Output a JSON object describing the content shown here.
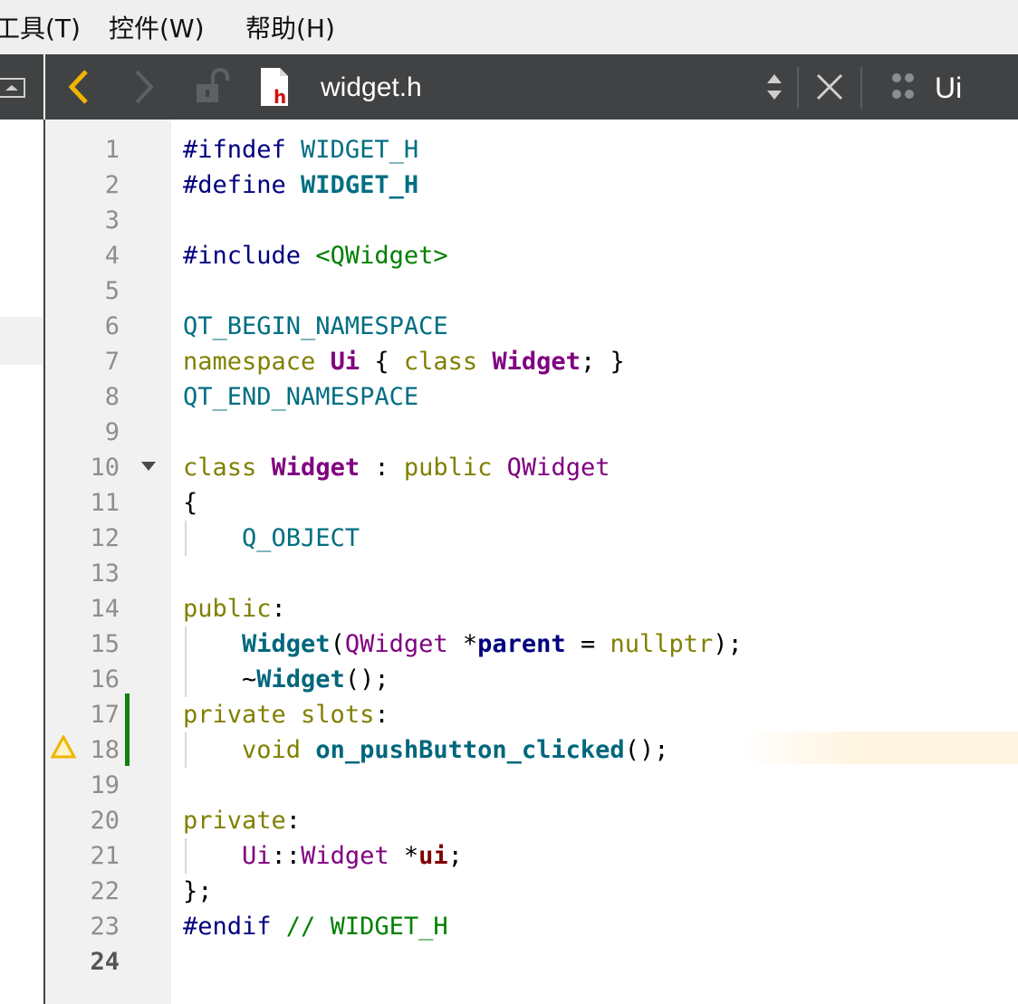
{
  "menubar": {
    "items": [
      {
        "label": "工具(T)"
      },
      {
        "label": "控件(W)"
      },
      {
        "label": "帮助(H)"
      }
    ]
  },
  "toolbar": {
    "file_name": "widget.h",
    "file_type_badge": "h",
    "symbol_label": "Ui",
    "icons": [
      "back-chevron-icon",
      "forward-chevron-icon",
      "unlock-icon",
      "header-file-icon",
      "sort-updown-icon",
      "close-icon",
      "split-grid-icon"
    ]
  },
  "editor": {
    "current_line": "24",
    "line_numbers": [
      "1",
      "2",
      "3",
      "4",
      "5",
      "6",
      "7",
      "8",
      "9",
      "10",
      "11",
      "12",
      "13",
      "14",
      "15",
      "16",
      "17",
      "18",
      "19",
      "20",
      "21",
      "22",
      "23",
      "24"
    ],
    "lines": [
      [
        {
          "t": "#ifndef ",
          "c": "pp"
        },
        {
          "t": "WIDGET_H",
          "c": "macro"
        }
      ],
      [
        {
          "t": "#define ",
          "c": "pp"
        },
        {
          "t": "WIDGET_H",
          "c": "macrob"
        }
      ],
      [],
      [
        {
          "t": "#include ",
          "c": "pp"
        },
        {
          "t": "<QWidget>",
          "c": "inc"
        }
      ],
      [],
      [
        {
          "t": "QT_BEGIN_NAMESPACE",
          "c": "macro"
        }
      ],
      [
        {
          "t": "namespace ",
          "c": "kw"
        },
        {
          "t": "Ui",
          "c": "clsb"
        },
        {
          "t": " { ",
          "c": "plain"
        },
        {
          "t": "class ",
          "c": "kw"
        },
        {
          "t": "Widget",
          "c": "clsb"
        },
        {
          "t": "; }",
          "c": "plain"
        }
      ],
      [
        {
          "t": "QT_END_NAMESPACE",
          "c": "macro"
        }
      ],
      [],
      [
        {
          "t": "class ",
          "c": "kw"
        },
        {
          "t": "Widget",
          "c": "clsb"
        },
        {
          "t": " : ",
          "c": "plain"
        },
        {
          "t": "public ",
          "c": "kw"
        },
        {
          "t": "QWidget",
          "c": "cls"
        }
      ],
      [
        {
          "t": "{",
          "c": "plain"
        }
      ],
      [
        {
          "t": "    ",
          "c": "plain"
        },
        {
          "t": "Q_OBJECT",
          "c": "macro"
        }
      ],
      [],
      [
        {
          "t": "public",
          "c": "kw"
        },
        {
          "t": ":",
          "c": "plain"
        }
      ],
      [
        {
          "t": "    ",
          "c": "plain"
        },
        {
          "t": "Widget",
          "c": "fnb"
        },
        {
          "t": "(",
          "c": "plain"
        },
        {
          "t": "QWidget",
          "c": "cls"
        },
        {
          "t": " *",
          "c": "plain"
        },
        {
          "t": "parent",
          "c": "par"
        },
        {
          "t": " = ",
          "c": "plain"
        },
        {
          "t": "nullptr",
          "c": "kw"
        },
        {
          "t": ");",
          "c": "plain"
        }
      ],
      [
        {
          "t": "    ~",
          "c": "plain"
        },
        {
          "t": "Widget",
          "c": "fnb"
        },
        {
          "t": "();",
          "c": "plain"
        }
      ],
      [
        {
          "t": "private ",
          "c": "kw"
        },
        {
          "t": "slots",
          "c": "kw"
        },
        {
          "t": ":",
          "c": "plain"
        }
      ],
      [
        {
          "t": "    ",
          "c": "plain"
        },
        {
          "t": "void ",
          "c": "kw"
        },
        {
          "t": "on_pushButton_clicked",
          "c": "fnb"
        },
        {
          "t": "();",
          "c": "plain"
        }
      ],
      [],
      [
        {
          "t": "private",
          "c": "kw"
        },
        {
          "t": ":",
          "c": "plain"
        }
      ],
      [
        {
          "t": "    ",
          "c": "plain"
        },
        {
          "t": "Ui",
          "c": "cls"
        },
        {
          "t": "::",
          "c": "plain"
        },
        {
          "t": "Widget",
          "c": "cls"
        },
        {
          "t": " *",
          "c": "plain"
        },
        {
          "t": "ui",
          "c": "mem"
        },
        {
          "t": ";",
          "c": "plain"
        }
      ],
      [
        {
          "t": "};",
          "c": "plain"
        }
      ],
      [
        {
          "t": "#endif ",
          "c": "pp"
        },
        {
          "t": "// WIDGET_H",
          "c": "cmt"
        }
      ],
      []
    ],
    "warning_line": "18",
    "changed_lines": [
      "17",
      "18"
    ],
    "foldable_line": "10"
  },
  "colors": {
    "toolbar_bg": "#404244",
    "gutter_bg": "#f1f1f1",
    "change_marker": "#108010",
    "warning": "#f0b400"
  }
}
